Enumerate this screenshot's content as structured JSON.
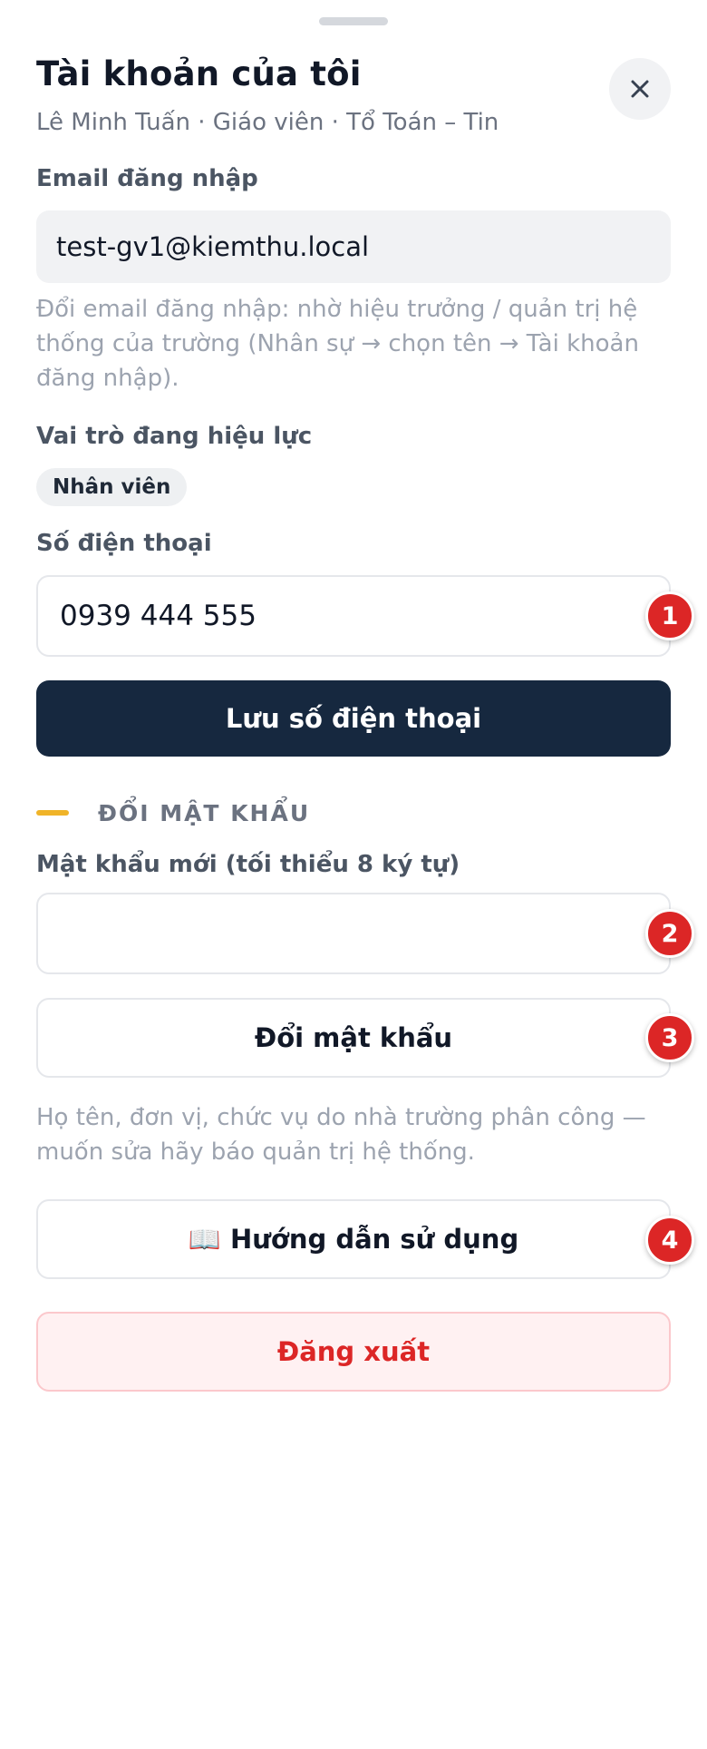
{
  "sheet": {
    "title": "Tài khoản của tôi",
    "subtitle": "Lê Minh Tuấn · Giáo viên · Tổ Toán – Tin",
    "close_icon": "close-icon"
  },
  "email": {
    "label": "Email đăng nhập",
    "value": "test-gv1@kiemthu.local",
    "hint": "Đổi email đăng nhập: nhờ hiệu trưởng / quản trị hệ thống của trường (Nhân sự → chọn tên → Tài khoản đăng nhập)."
  },
  "role": {
    "label": "Vai trò đang hiệu lực",
    "chip": "Nhân viên"
  },
  "phone": {
    "label": "Số điện thoại",
    "value": "0939 444 555",
    "save_button": "Lưu số điện thoại"
  },
  "password": {
    "section_title": "ĐỔI MẬT KHẨU",
    "label": "Mật khẩu mới (tối thiểu 8 ký tự)",
    "value": "",
    "change_button": "Đổi mật khẩu"
  },
  "info_hint": "Họ tên, đơn vị, chức vụ do nhà trường phân công — muốn sửa hãy báo quản trị hệ thống.",
  "guide_button": "📖 Hướng dẫn sử dụng",
  "logout_button": "Đăng xuất",
  "badges": [
    "1",
    "2",
    "3",
    "4"
  ],
  "colors": {
    "primary": "#16283f",
    "accent": "#f0b429",
    "danger": "#dc2626",
    "badge": "#dc2626"
  }
}
